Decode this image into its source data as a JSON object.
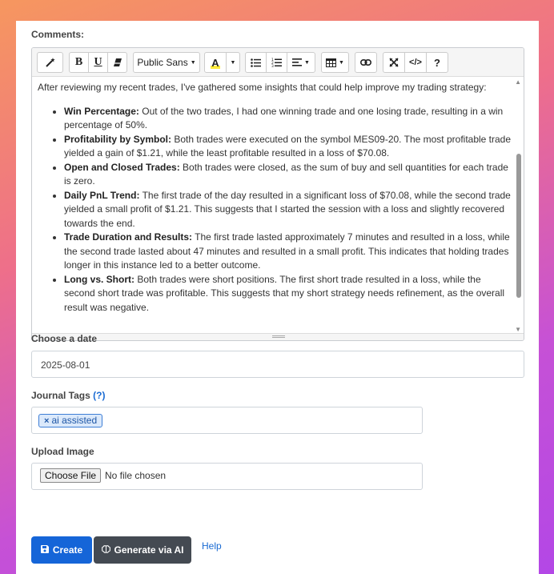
{
  "comments": {
    "label": "Comments:",
    "toolbar": {
      "font_name": "Public Sans",
      "font_color_letter": "A",
      "help_symbol": "?",
      "code_symbol": "</>"
    },
    "intro": "After reviewing my recent trades, I've gathered some insights that could help improve my trading strategy:",
    "items": [
      {
        "title": "Win Percentage:",
        "text": " Out of the two trades, I had one winning trade and one losing trade, resulting in a win percentage of 50%."
      },
      {
        "title": "Profitability by Symbol:",
        "text": " Both trades were executed on the symbol MES09-20. The most profitable trade yielded a gain of $1.21, while the least profitable resulted in a loss of $70.08."
      },
      {
        "title": "Open and Closed Trades:",
        "text": " Both trades were closed, as the sum of buy and sell quantities for each trade is zero."
      },
      {
        "title": "Daily PnL Trend:",
        "text": " The first trade of the day resulted in a significant loss of $70.08, while the second trade yielded a small profit of $1.21. This suggests that I started the session with a loss and slightly recovered towards the end."
      },
      {
        "title": "Trade Duration and Results:",
        "text": " The first trade lasted approximately 7 minutes and resulted in a loss, while the second trade lasted about 47 minutes and resulted in a small profit. This indicates that holding trades longer in this instance led to a better outcome."
      },
      {
        "title": "Long vs. Short:",
        "text": " Both trades were short positions. The first short trade resulted in a loss, while the second short trade was profitable. This suggests that my short strategy needs refinement, as the overall result was negative."
      }
    ]
  },
  "date": {
    "label": "Choose a date",
    "value": "2025-08-01"
  },
  "tags": {
    "label": "Journal Tags",
    "help": "(?)",
    "remove_symbol": "×",
    "items": [
      "ai assisted"
    ]
  },
  "upload": {
    "label": "Upload Image",
    "button": "Choose File",
    "status": "No file chosen"
  },
  "actions": {
    "create": "Create",
    "generate": "Generate via AI",
    "help": "Help"
  },
  "colors": {
    "primary": "#1565d8",
    "dark_button": "#444a52",
    "link": "#1a6bd3"
  }
}
